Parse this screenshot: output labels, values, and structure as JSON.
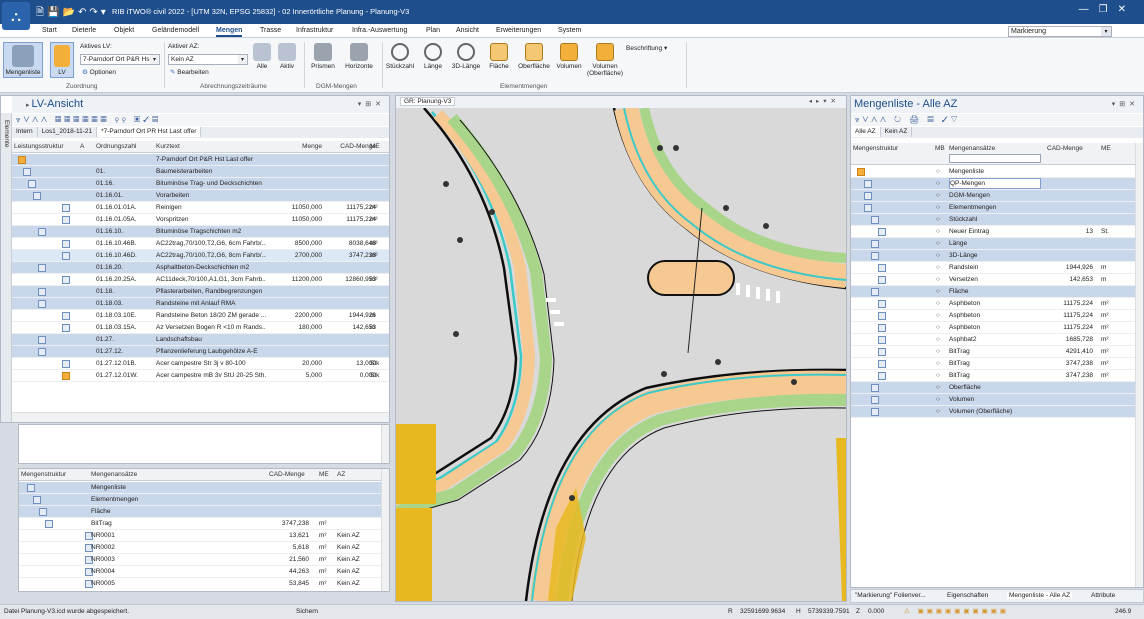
{
  "titlebar": {
    "title": "RIB iTWO® civil 2022 - [UTM 32N, EPSG 25832] - 02 Innerörtliche Planung - Planung-V3"
  },
  "ribbon_tabs": [
    "Start",
    "Dieterle",
    "Objekt",
    "Geländemodell",
    "Mengen",
    "Trasse",
    "Infrastruktur",
    "Infra.-Auswertung",
    "Plan",
    "Ansicht",
    "Erweiterungen",
    "System"
  ],
  "active_tab": "Mengen",
  "markierung": "Markierung",
  "ribbon": {
    "mengenliste": "Mengenliste",
    "lv": "LV",
    "aktives_lv_label": "Aktives LV:",
    "aktives_lv_value": "7-Parndorf Ort P&R Hs",
    "optionen": "Optionen",
    "zuordnung": "Zuordnung",
    "aktiver_az_label": "Aktiver AZ:",
    "aktiver_az_value": "Kein AZ",
    "bearbeiten": "Bearbeiten",
    "alle": "Alle",
    "aktiv": "Aktiv",
    "abrechnungs": "Abrechnungszeiträume",
    "prismen": "Prismen",
    "horizonte": "Horizonte",
    "dgm_mengen": "DGM-Mengen",
    "stueckzahl": "Stückzahl",
    "laenge": "Länge",
    "laenge3d": "3D-Länge",
    "flaeche": "Fläche",
    "oberflaeche": "Oberfläche",
    "volumen": "Volumen",
    "volumen_ob": "Volumen (Oberfläche)",
    "beschriftung": "Beschriftung",
    "elementmengen": "Elementmengen"
  },
  "lv_panel": {
    "title": "LV-Ansicht",
    "side_tab": "Elemente",
    "subtabs": [
      "Intern",
      "Los1_2018-11-21",
      "*7-Parndorf Ort PR Hst Last offer"
    ],
    "columns": [
      "Leistungsstruktur",
      "A",
      "Ordnungszahl",
      "Kurztext",
      "Menge",
      "CAD-Menge",
      "ME"
    ],
    "rows": [
      {
        "oz": "",
        "text": "7-Parndorf Ort P&R Hst Last offer",
        "menge": "",
        "cad": "",
        "me": "",
        "g": true
      },
      {
        "oz": "01.",
        "text": "Baumeisterarbeiten",
        "menge": "",
        "cad": "",
        "me": "",
        "g": true
      },
      {
        "oz": "01.16.",
        "text": "Bituminöse Trag- und Deckschichten",
        "menge": "",
        "cad": "",
        "me": "",
        "g": true
      },
      {
        "oz": "01.16.01.",
        "text": "Vorarbeiten",
        "menge": "",
        "cad": "",
        "me": "",
        "g": true
      },
      {
        "oz": "01.16.01.01A.",
        "text": "Reinigen",
        "menge": "11050,000",
        "cad": "11175,224",
        "me": "m²",
        "g": false
      },
      {
        "oz": "01.16.01.05A.",
        "text": "Vorspritzen",
        "menge": "11050,000",
        "cad": "11175,224",
        "me": "m²",
        "g": false
      },
      {
        "oz": "01.16.10.",
        "text": "Bituminöse Tragschichten m2",
        "menge": "",
        "cad": "",
        "me": "",
        "g": true
      },
      {
        "oz": "01.16.10.46B.",
        "text": "AC22trag,70/100,T2,G6, 6cm Fahrb/...",
        "menge": "8500,000",
        "cad": "8038,648",
        "me": "m²",
        "g": false
      },
      {
        "oz": "01.16.10.46D.",
        "text": "AC22trag,70/100,T2,G6, 8cm Fahrb/...",
        "menge": "2700,000",
        "cad": "3747,238",
        "me": "m²",
        "g": false,
        "sel": true
      },
      {
        "oz": "01.16.20.",
        "text": "Asphaltbeton-Deckschichten m2",
        "menge": "",
        "cad": "",
        "me": "",
        "g": true
      },
      {
        "oz": "01.16.20.25A.",
        "text": "AC11deck,70/100,A1,G1, 3cm Fahrb...",
        "menge": "11200,000",
        "cad": "12860,953",
        "me": "m²",
        "g": false
      },
      {
        "oz": "01.18.",
        "text": "Pflasterarbeiten, Randbegrenzungen",
        "menge": "",
        "cad": "",
        "me": "",
        "g": true
      },
      {
        "oz": "01.18.03.",
        "text": "Randsteine mit Anlauf RMA",
        "menge": "",
        "cad": "",
        "me": "",
        "g": true
      },
      {
        "oz": "01.18.03.10E.",
        "text": "Randsteine Beton 18/20 ZM gerade ...",
        "menge": "2200,000",
        "cad": "1944,926",
        "me": "m",
        "g": false
      },
      {
        "oz": "01.18.03.15A.",
        "text": "Az Versetzen Bogen R <10 m  Rands...",
        "menge": "180,000",
        "cad": "142,653",
        "me": "m",
        "g": false
      },
      {
        "oz": "01.27.",
        "text": "Landschaftsbau",
        "menge": "",
        "cad": "",
        "me": "",
        "g": true
      },
      {
        "oz": "01.27.12.",
        "text": "Pflanzenlieferung Laubgehölze A-E",
        "menge": "",
        "cad": "",
        "me": "",
        "g": true
      },
      {
        "oz": "01.27.12.01B.",
        "text": "Acer campestre Str 3j v 80-100",
        "menge": "20,000",
        "cad": "13,000",
        "me": "Stk",
        "g": false
      },
      {
        "oz": "01.27.12.01W.",
        "text": "Acer campestre mB 3v StU 20-25 Sth...",
        "menge": "5,000",
        "cad": "0,000",
        "me": "Stk",
        "g": false
      }
    ]
  },
  "lower_panel": {
    "columns": [
      "Mengenstruktur",
      "Mengenansätze",
      "CAD-Menge",
      "ME",
      "AZ"
    ],
    "rows": [
      {
        "name": "Mengenliste",
        "cad": "",
        "me": "",
        "az": "",
        "g": true
      },
      {
        "name": "Elementmengen",
        "cad": "",
        "me": "",
        "az": "",
        "g": true
      },
      {
        "name": "Fläche",
        "cad": "",
        "me": "",
        "az": "",
        "g": true
      },
      {
        "name": "BitTrag",
        "cad": "3747,238",
        "me": "m²",
        "az": "",
        "g": false
      },
      {
        "name": "NR0001",
        "cad": "13,621",
        "me": "m²",
        "az": "Kein AZ",
        "g": false
      },
      {
        "name": "NR0002",
        "cad": "5,618",
        "me": "m²",
        "az": "Kein AZ",
        "g": false
      },
      {
        "name": "NR0003",
        "cad": "21,560",
        "me": "m²",
        "az": "Kein AZ",
        "g": false
      },
      {
        "name": "NR0004",
        "cad": "44,263",
        "me": "m²",
        "az": "Kein AZ",
        "g": false
      },
      {
        "name": "NR0005",
        "cad": "53,845",
        "me": "m²",
        "az": "Kein AZ",
        "g": false
      }
    ]
  },
  "map_panel": {
    "title": "GR: Planung-V3"
  },
  "right_panel": {
    "title": "Mengenliste - Alle AZ",
    "subtabs": [
      "Alle AZ",
      "Kein AZ"
    ],
    "columns": [
      "Mengenstruktur",
      "MB",
      "Mengenansätze",
      "CAD-Menge",
      "ME"
    ],
    "rows": [
      {
        "name": "Mengenliste",
        "cad": "",
        "me": "",
        "g": false
      },
      {
        "name": "QP-Mengen",
        "cad": "",
        "me": "",
        "g": true,
        "sel": true
      },
      {
        "name": "DGM-Mengen",
        "cad": "",
        "me": "",
        "g": true
      },
      {
        "name": "Elementmengen",
        "cad": "",
        "me": "",
        "g": true
      },
      {
        "name": "Stückzahl",
        "cad": "",
        "me": "",
        "g": true
      },
      {
        "name": "Neuer Eintrag",
        "cad": "13",
        "me": "St.",
        "g": false
      },
      {
        "name": "Länge",
        "cad": "",
        "me": "",
        "g": true
      },
      {
        "name": "3D-Länge",
        "cad": "",
        "me": "",
        "g": true
      },
      {
        "name": "Randstein",
        "cad": "1944,926",
        "me": "m",
        "g": false
      },
      {
        "name": "Versetzen",
        "cad": "142,653",
        "me": "m",
        "g": false
      },
      {
        "name": "Fläche",
        "cad": "",
        "me": "",
        "g": true
      },
      {
        "name": "Asphbeton",
        "cad": "11175,224",
        "me": "m²",
        "g": false
      },
      {
        "name": "Asphbeton",
        "cad": "11175,224",
        "me": "m²",
        "g": false
      },
      {
        "name": "Asphbeton",
        "cad": "11175,224",
        "me": "m²",
        "g": false
      },
      {
        "name": "Asphbat2",
        "cad": "1685,728",
        "me": "m²",
        "g": false
      },
      {
        "name": "BitTrag",
        "cad": "4291,410",
        "me": "m²",
        "g": false
      },
      {
        "name": "BitTrag",
        "cad": "3747,238",
        "me": "m²",
        "g": false
      },
      {
        "name": "BitTrag",
        "cad": "3747,238",
        "me": "m²",
        "g": false
      },
      {
        "name": "Oberfläche",
        "cad": "",
        "me": "",
        "g": true
      },
      {
        "name": "Volumen",
        "cad": "",
        "me": "",
        "g": true
      },
      {
        "name": "Volumen (Oberfläche)",
        "cad": "",
        "me": "",
        "g": true
      }
    ],
    "bottom_tabs": [
      "\"Markierung\" Folienver...",
      "Eigenschaften",
      "Mengenliste - Alle AZ",
      "Attribute"
    ]
  },
  "status": {
    "message": "Datei Planung-V3.icd wurde abgespeichert.",
    "sichern": "Sichern",
    "r_label": "R",
    "r_value": "32591699.9634",
    "h_label": "H",
    "h_value": "5739339.7591",
    "z_label": "Z",
    "z_value": "0.000",
    "zoom": "246.9"
  }
}
